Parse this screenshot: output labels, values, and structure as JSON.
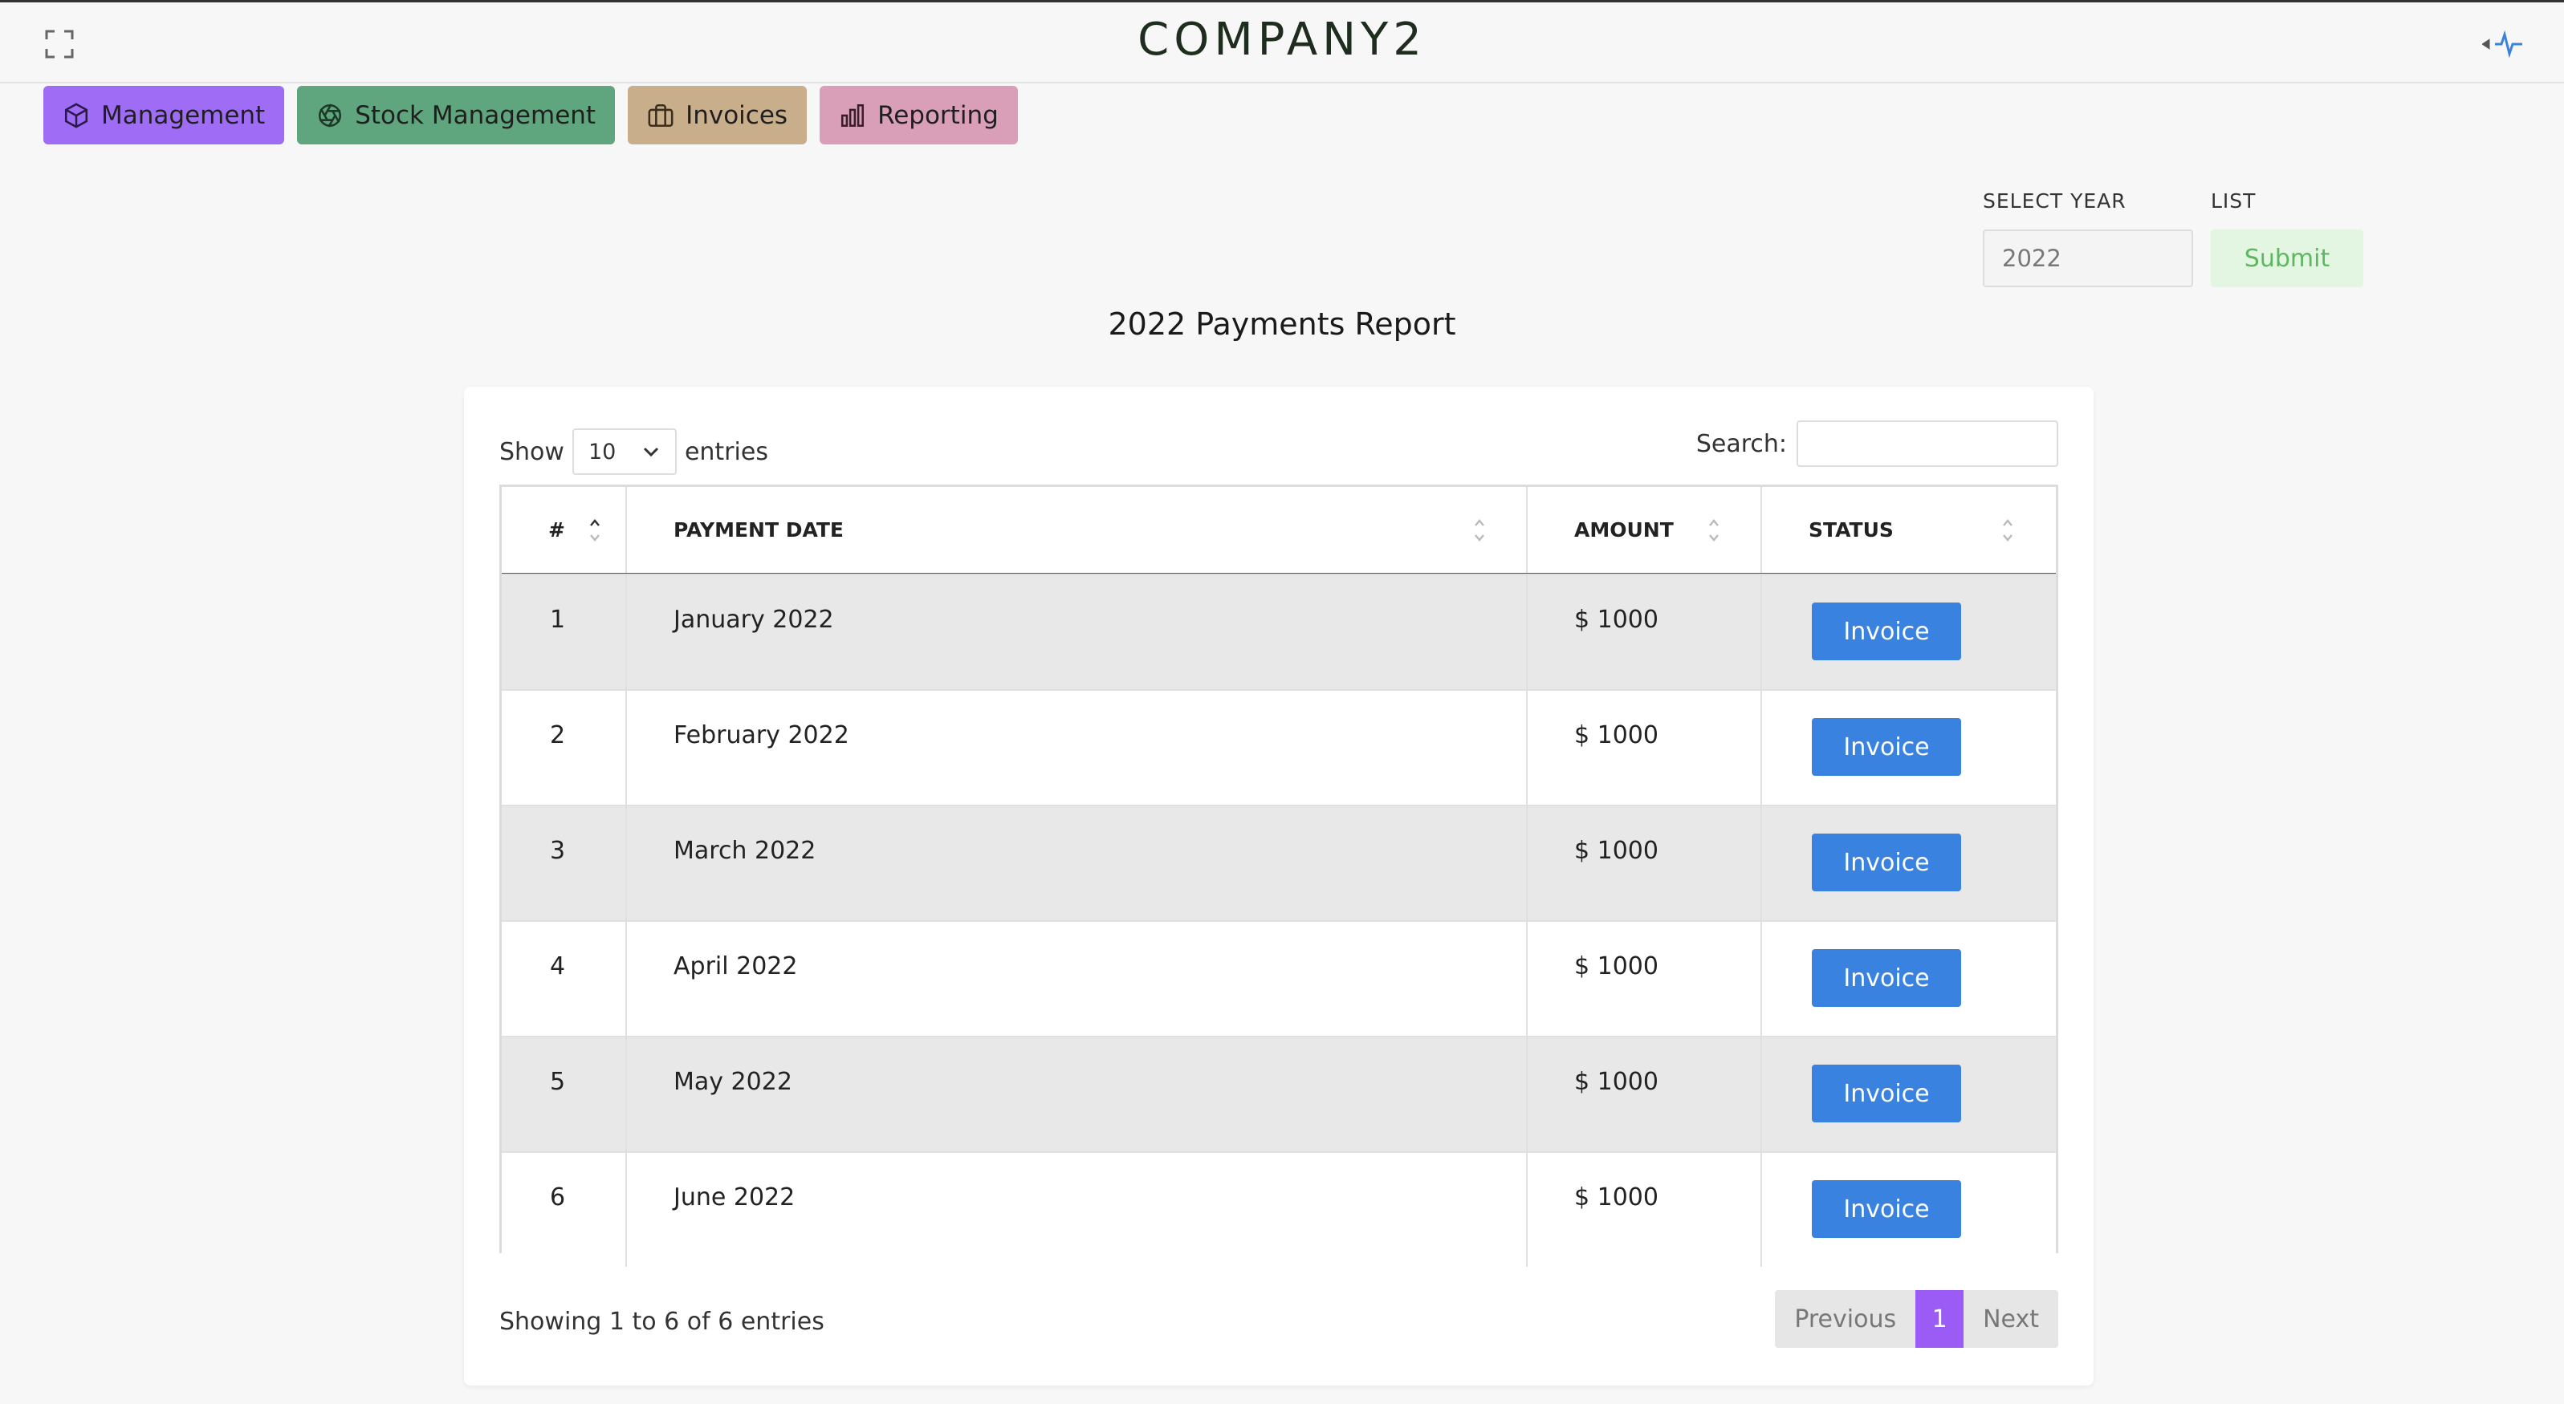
{
  "app": {
    "brand": "COMPANY2"
  },
  "nav": [
    {
      "label": "Management",
      "icon": "cube-icon",
      "color": "#9f6cf5"
    },
    {
      "label": "Stock Management",
      "icon": "aperture-icon",
      "color": "#5fa57d"
    },
    {
      "label": "Invoices",
      "icon": "briefcase-icon",
      "color": "#c9ae8b"
    },
    {
      "label": "Reporting",
      "icon": "bar-chart-icon",
      "color": "#da9fb8"
    }
  ],
  "filters": {
    "year_label": "SELECT YEAR",
    "year_value": "2022",
    "list_label": "LIST",
    "submit_label": "Submit"
  },
  "report": {
    "title": "2022 Payments Report"
  },
  "table_controls": {
    "show_label": "Show",
    "page_length": "10",
    "entries_label": "entries",
    "search_label": "Search:"
  },
  "columns": [
    "#",
    "PAYMENT DATE",
    "AMOUNT",
    "STATUS"
  ],
  "rows": [
    {
      "num": "1",
      "date": "January 2022",
      "amount": "$ 1000",
      "action": "Invoice"
    },
    {
      "num": "2",
      "date": "February 2022",
      "amount": "$ 1000",
      "action": "Invoice"
    },
    {
      "num": "3",
      "date": "March 2022",
      "amount": "$ 1000",
      "action": "Invoice"
    },
    {
      "num": "4",
      "date": "April 2022",
      "amount": "$ 1000",
      "action": "Invoice"
    },
    {
      "num": "5",
      "date": "May 2022",
      "amount": "$ 1000",
      "action": "Invoice"
    },
    {
      "num": "6",
      "date": "June 2022",
      "amount": "$ 1000",
      "action": "Invoice"
    }
  ],
  "footer": {
    "info": "Showing 1 to 6 of 6 entries",
    "prev_label": "Previous",
    "current_page": "1",
    "next_label": "Next"
  },
  "colors": {
    "accent": "#9a5cf5",
    "invoice_button": "#3a82e0",
    "submit_text": "#5fb660"
  }
}
